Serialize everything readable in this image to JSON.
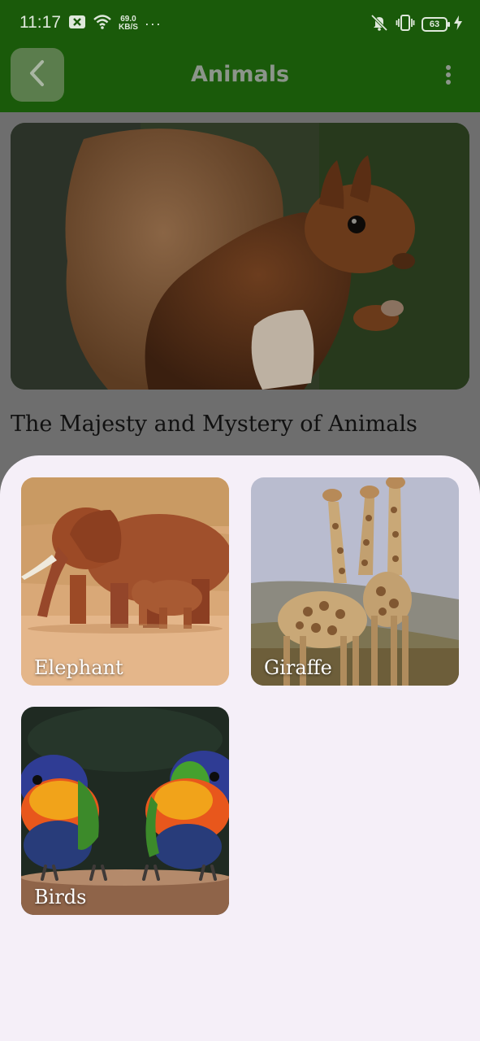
{
  "status_bar": {
    "time": "11:17",
    "net_speed_value": "69.0",
    "net_speed_unit": "KB/S",
    "more_indicator": "···",
    "battery_level": "63"
  },
  "app_bar": {
    "title": "Animals"
  },
  "main": {
    "headline": "The Majesty and Mystery of Animals"
  },
  "sheet": {
    "items": [
      {
        "label": "Elephant"
      },
      {
        "label": "Giraffe"
      },
      {
        "label": "Birds"
      }
    ]
  },
  "colors": {
    "app_bar": "#1a5a0a",
    "sheet_background": "#f5eff8",
    "scrim": "#6e6e6e"
  }
}
